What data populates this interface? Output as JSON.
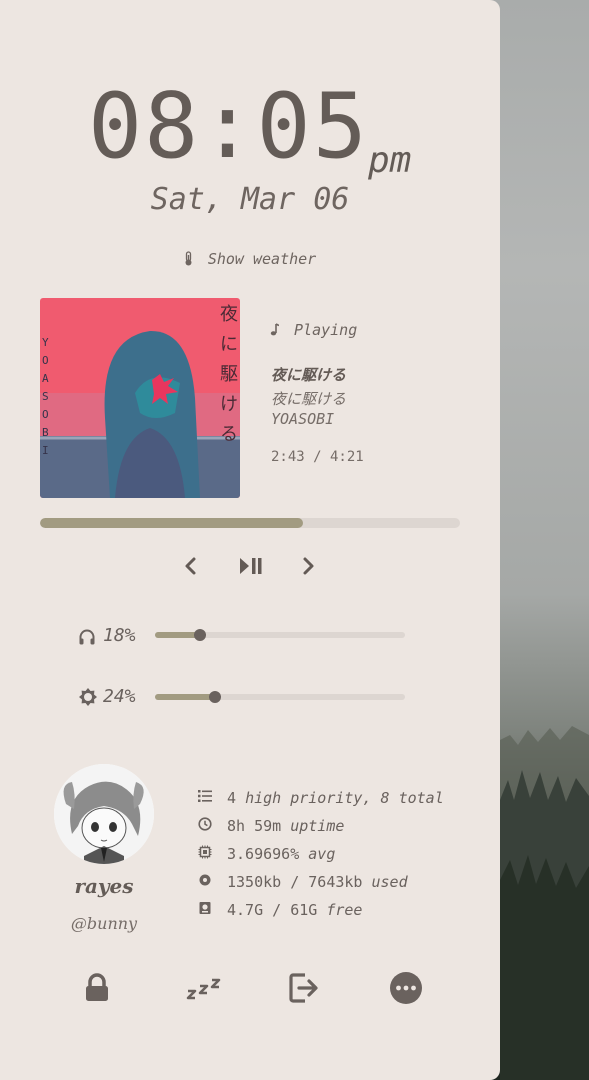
{
  "clock": {
    "time": "08:05",
    "ampm": "pm",
    "date": "Sat, Mar 06"
  },
  "weather": {
    "label": "Show weather",
    "icon": "thermometer-icon"
  },
  "media": {
    "status": "Playing",
    "status_icon": "music-note-icon",
    "track": "夜に駆ける",
    "album": "夜に駆ける",
    "artist": "YOASOBI",
    "time": "2:43 / 4:21",
    "progress": 0.626,
    "cover_text_vertical": "夜に駆ける",
    "cover_text_side": "YOASOBI"
  },
  "controls": {
    "prev_icon": "chevron-left-icon",
    "play_pause_icon": "play-pause-icon",
    "next_icon": "chevron-right-icon"
  },
  "volume": {
    "label": "18%",
    "value": 0.18,
    "icon": "headphones-icon"
  },
  "brightness": {
    "label": "24%",
    "value": 0.24,
    "icon": "brightness-icon"
  },
  "user": {
    "name": "rayes",
    "handle": "@bunny"
  },
  "stats": [
    {
      "icon": "list-icon",
      "value": "4",
      "text": "high priority, 8 total"
    },
    {
      "icon": "clock-icon",
      "value": "8h 59m",
      "text": "uptime"
    },
    {
      "icon": "cpu-icon",
      "value": "3.69696%",
      "text": "avg"
    },
    {
      "icon": "memory-icon",
      "value": "1350kb / 7643kb",
      "text": "used"
    },
    {
      "icon": "disk-icon",
      "value": "4.7G / 61G",
      "text": "free"
    }
  ],
  "actions": [
    "lock-icon",
    "sleep-icon",
    "logout-icon",
    "more-icon"
  ],
  "colors": {
    "panel": "#ede6e1",
    "text": "#6a625e",
    "accent": "#a29b81",
    "track": "#ddd6d1"
  }
}
